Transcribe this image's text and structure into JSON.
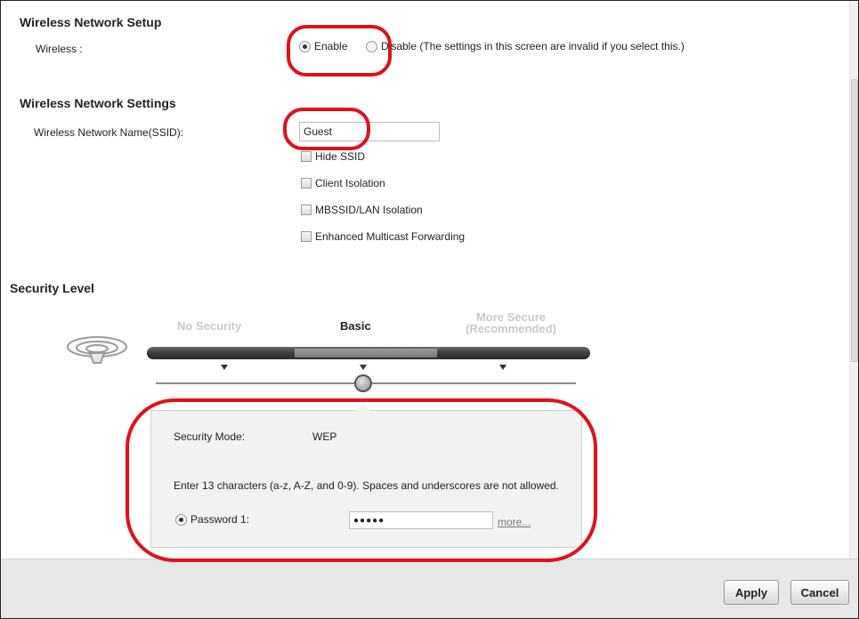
{
  "setup": {
    "title": "Wireless Network Setup",
    "wireless_label": "Wireless :",
    "enable_label": "Enable",
    "disable_label": "Disable (The settings in this screen are invalid if you select this.)",
    "selected": "Enable"
  },
  "settings": {
    "title": "Wireless Network Settings",
    "ssid_label": "Wireless Network Name(SSID):",
    "ssid_value": "Guest",
    "options": [
      {
        "label": "Hide SSID",
        "checked": false
      },
      {
        "label": "Client Isolation",
        "checked": false
      },
      {
        "label": "MBSSID/LAN Isolation",
        "checked": false
      },
      {
        "label": "Enhanced Multicast Forwarding",
        "checked": false
      }
    ]
  },
  "security": {
    "title": "Security Level",
    "levels": [
      "No Security",
      "Basic",
      "More Secure\n(Recommended)"
    ],
    "selected_level": "Basic",
    "mode_label": "Security Mode:",
    "mode_value": "WEP",
    "hint": "Enter 13 characters (a-z, A-Z, and 0-9). Spaces and underscores are not allowed.",
    "password_label": "Password 1:",
    "password_value": "●●●●●",
    "more_link": "more..."
  },
  "footer": {
    "apply_label": "Apply",
    "cancel_label": "Cancel"
  },
  "colors": {
    "highlight": "#e0101a",
    "slider_dark": "#2a2a2a",
    "inactive_level": "#c8c8c8"
  }
}
